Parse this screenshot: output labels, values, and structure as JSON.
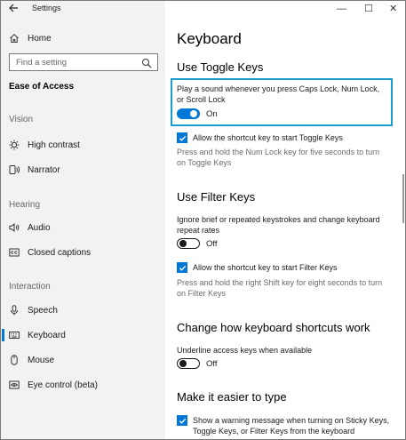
{
  "window": {
    "title": "Settings",
    "minimize": "—",
    "maximize": "☐",
    "close": "✕"
  },
  "sidebar": {
    "home": "Home",
    "search_placeholder": "Find a setting",
    "section": "Ease of Access",
    "groups": {
      "vision": "Vision",
      "hearing": "Hearing",
      "interaction": "Interaction"
    },
    "items": {
      "high_contrast": "High contrast",
      "narrator": "Narrator",
      "audio": "Audio",
      "closed_captions": "Closed captions",
      "speech": "Speech",
      "keyboard": "Keyboard",
      "mouse": "Mouse",
      "eye_control": "Eye control (beta)"
    }
  },
  "main": {
    "title": "Keyboard",
    "toggle_keys": {
      "heading": "Use Toggle Keys",
      "description": "Play a sound whenever you press Caps Lock, Num Lock, or Scroll Lock",
      "state": "On",
      "shortcut_label": "Allow the shortcut key to start Toggle Keys",
      "shortcut_hint": "Press and hold the Num Lock key for five seconds to turn on Toggle Keys"
    },
    "filter_keys": {
      "heading": "Use Filter Keys",
      "description": "Ignore brief or repeated keystrokes and change keyboard repeat rates",
      "state": "Off",
      "shortcut_label": "Allow the shortcut key to start Filter Keys",
      "shortcut_hint": "Press and hold the right Shift key for eight seconds to turn on Filter Keys"
    },
    "shortcuts": {
      "heading": "Change how keyboard shortcuts work",
      "description": "Underline access keys when available",
      "state": "Off"
    },
    "typing": {
      "heading": "Make it easier to type",
      "warning_label": "Show a warning message when turning on Sticky Keys, Toggle Keys, or Filter Keys from the keyboard"
    }
  },
  "colors": {
    "accent": "#0078d7",
    "highlight_border": "#1a9ccf",
    "sidebar_bg": "#f2f2f2"
  }
}
